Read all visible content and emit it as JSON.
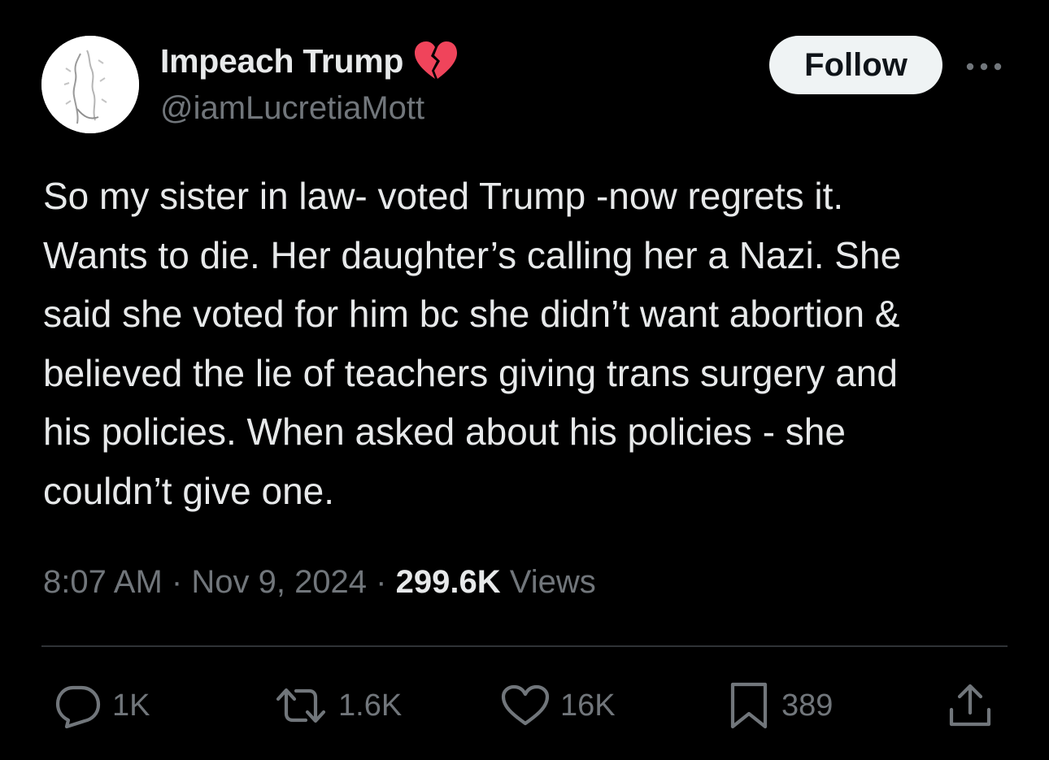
{
  "user": {
    "display_name": "Impeach Trump",
    "name_emoji": "broken-heart-emoji",
    "handle": "@iamLucretiaMott"
  },
  "follow_label": "Follow",
  "tweet_lines": [
    "So my sister in law- voted Trump -now regrets it.",
    "Wants to die. Her daughter’s calling her a Nazi. She",
    "said she voted for him bc she didn’t want abortion &",
    "believed the lie of teachers giving trans surgery and",
    "his policies. When asked about his policies - she",
    "couldn’t give one."
  ],
  "meta": {
    "time": "8:07 AM",
    "separator": "·",
    "date": "Nov 9, 2024",
    "views_count": "299.6K",
    "views_label": "Views"
  },
  "actions": {
    "replies": "1K",
    "reposts": "1.6K",
    "likes": "16K",
    "bookmarks": "389"
  },
  "colors": {
    "background": "#000000",
    "text_primary": "#e7e9ea",
    "text_secondary": "#71767b",
    "follow_bg": "#eff3f4",
    "divider": "#2f3336",
    "heart": "#f0445b"
  }
}
